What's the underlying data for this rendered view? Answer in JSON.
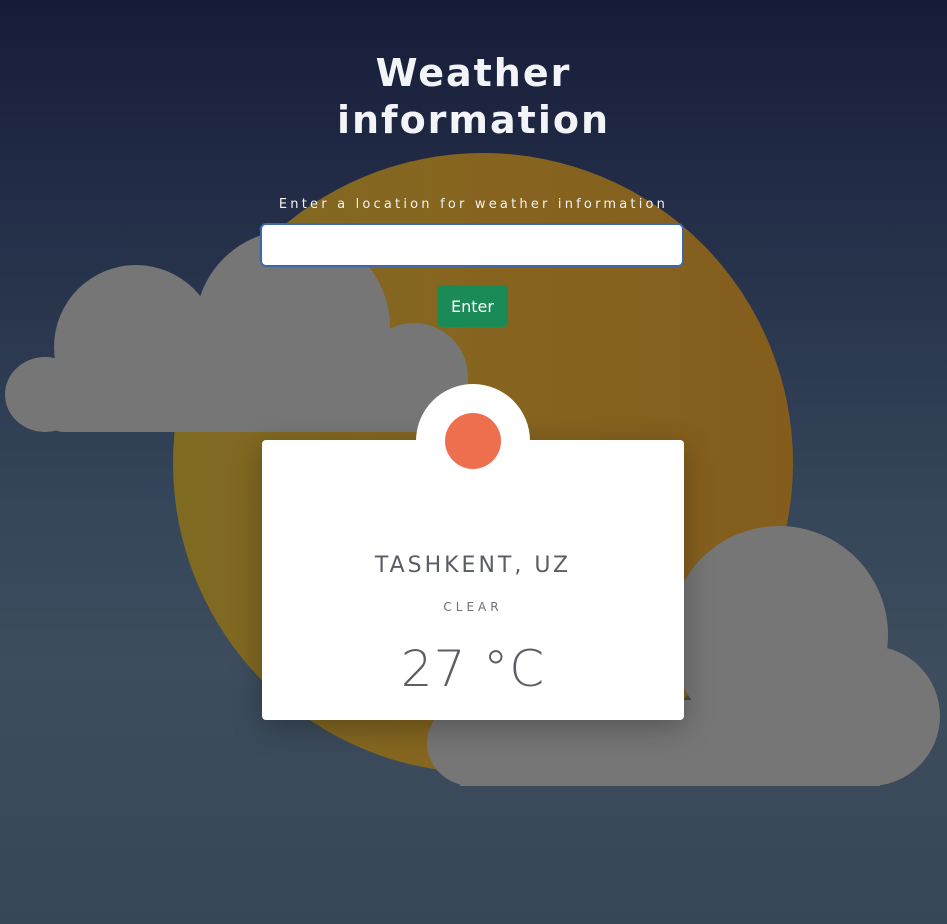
{
  "title": {
    "line1": "Weather",
    "line2": "information"
  },
  "search": {
    "label": "Enter a location for weather information",
    "value": "",
    "button_label": "Enter"
  },
  "weather_card": {
    "location": "TASHKENT, UZ",
    "condition": "CLEAR",
    "temperature": "27 °C",
    "icon": "sun-icon"
  },
  "colors": {
    "sun": "#86651f",
    "cloud": "#767676",
    "button": "#1a8a57",
    "weather_icon": "#ee6f4d"
  }
}
